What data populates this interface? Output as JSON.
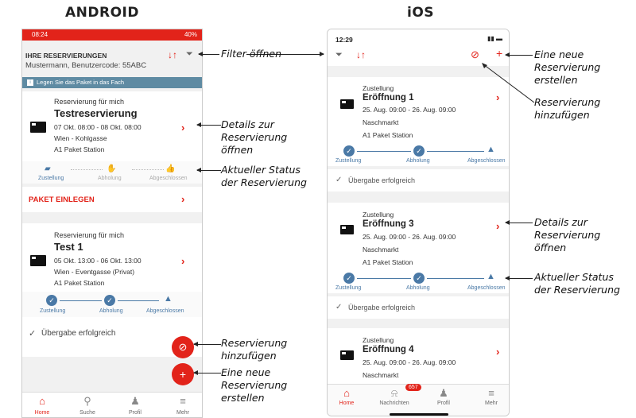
{
  "titles": {
    "android": "ANDROID",
    "ios": "iOS"
  },
  "android": {
    "status_time": "08:24",
    "status_right": "40%",
    "header_title": "IHRE RESERVIERUNGEN",
    "header_sub": "Mustermann, Benutzercode: 55ABC",
    "info_banner": "Legen Sie das Paket in das Fach",
    "card1": {
      "kind": "Reservierung für mich",
      "name": "Testreservierung",
      "date": "07 Okt. 08:00 - 08 Okt. 08:00",
      "loc": "Wien - Kohlgasse",
      "station": "A1 Paket Station",
      "action": "PAKET EINLEGEN"
    },
    "steps": [
      "Zustellung",
      "Abholung",
      "Abgeschlossen"
    ],
    "card2": {
      "kind": "Reservierung für mich",
      "name": "Test 1",
      "date": "05 Okt. 13:00 - 06 Okt. 13:00",
      "loc": "Wien - Eventgasse (Privat)",
      "station": "A1 Paket Station",
      "done": "Übergabe erfolgreich"
    },
    "nav": [
      "Home",
      "Suche",
      "Profil",
      "Mehr"
    ]
  },
  "ios": {
    "status_time": "12:29",
    "cards": [
      {
        "kind": "Zustellung",
        "name": "Eröffnung 1",
        "date": "25. Aug. 09:00 - 26. Aug. 09:00",
        "loc": "Naschmarkt",
        "station": "A1 Paket Station"
      },
      {
        "kind": "Zustellung",
        "name": "Eröffnung 3",
        "date": "25. Aug. 09:00 - 26. Aug. 09:00",
        "loc": "Naschmarkt",
        "station": "A1 Paket Station"
      },
      {
        "kind": "Zustellung",
        "name": "Eröffnung 4",
        "date": "25. Aug. 09:00 - 26. Aug. 09:00",
        "loc": "Naschmarkt"
      }
    ],
    "steps": [
      "Zustellung",
      "Abholung",
      "Abgeschlossen"
    ],
    "done": "Übergabe erfolgreich",
    "nav": [
      "Home",
      "Nachrichten",
      "Profil",
      "Mehr"
    ],
    "badge": "657"
  },
  "annotations": {
    "filter": "Filter öffnen",
    "new_res": "Eine neue\nReservierung\nerstellen",
    "add_res": "Reservierung\nhinzufügen",
    "details": "Details zur\nReservierung\nöffnen",
    "status": "Aktueller Status\nder Reservierung",
    "ios_details": "Details zur\nReservierung\nöffnen",
    "ios_status": "Aktueller Status\nder Reservierung",
    "and_add": "Reservierung\nhinzufügen",
    "and_new": "Eine neue\nReservierung\nerstellen"
  },
  "colors": {
    "accent": "#e2231a",
    "status_blue": "#4a79a6",
    "info_bar": "#5f8ba3"
  }
}
